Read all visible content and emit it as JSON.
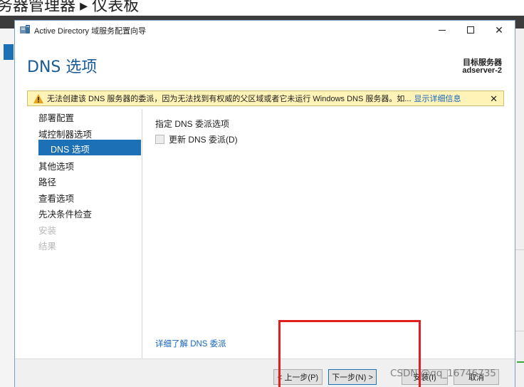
{
  "background": {
    "title": "务器管理器 ▸ 仪表板"
  },
  "window": {
    "title": "Active Directory 域服务配置向导",
    "minimize": "—",
    "maximize": "☐",
    "close": "✕"
  },
  "header": {
    "page_title": "DNS 选项",
    "target_label": "目标服务器",
    "target_value": "adserver-2"
  },
  "warning": {
    "text": "无法创建该 DNS 服务器的委派，因为无法找到有权威的父区域或者它未运行 Windows DNS 服务器。如...",
    "link": "显示详细信息",
    "close": "✕"
  },
  "nav": {
    "items": [
      {
        "label": "部署配置",
        "state": "normal"
      },
      {
        "label": "域控制器选项",
        "state": "normal"
      },
      {
        "label": "DNS 选项",
        "state": "selected"
      },
      {
        "label": "其他选项",
        "state": "normal"
      },
      {
        "label": "路径",
        "state": "normal"
      },
      {
        "label": "查看选项",
        "state": "normal"
      },
      {
        "label": "先决条件检查",
        "state": "normal"
      },
      {
        "label": "安装",
        "state": "disabled"
      },
      {
        "label": "结果",
        "state": "disabled"
      }
    ]
  },
  "content": {
    "section_label": "指定 DNS 委派选项",
    "checkbox_label": "更新 DNS 委派(D)",
    "checkbox_checked": false,
    "learn_more": "详细了解 DNS 委派"
  },
  "footer": {
    "prev": "< 上一步(P)",
    "next": "下一步(N) >",
    "install": "安装(I)",
    "cancel": "取消"
  },
  "watermark": "CSDN @qq_16746735",
  "colors": {
    "accent": "#1b70b6",
    "title_blue": "#1a5a96",
    "warning_bg": "#fff3b8",
    "annotation_red": "#e02020"
  }
}
